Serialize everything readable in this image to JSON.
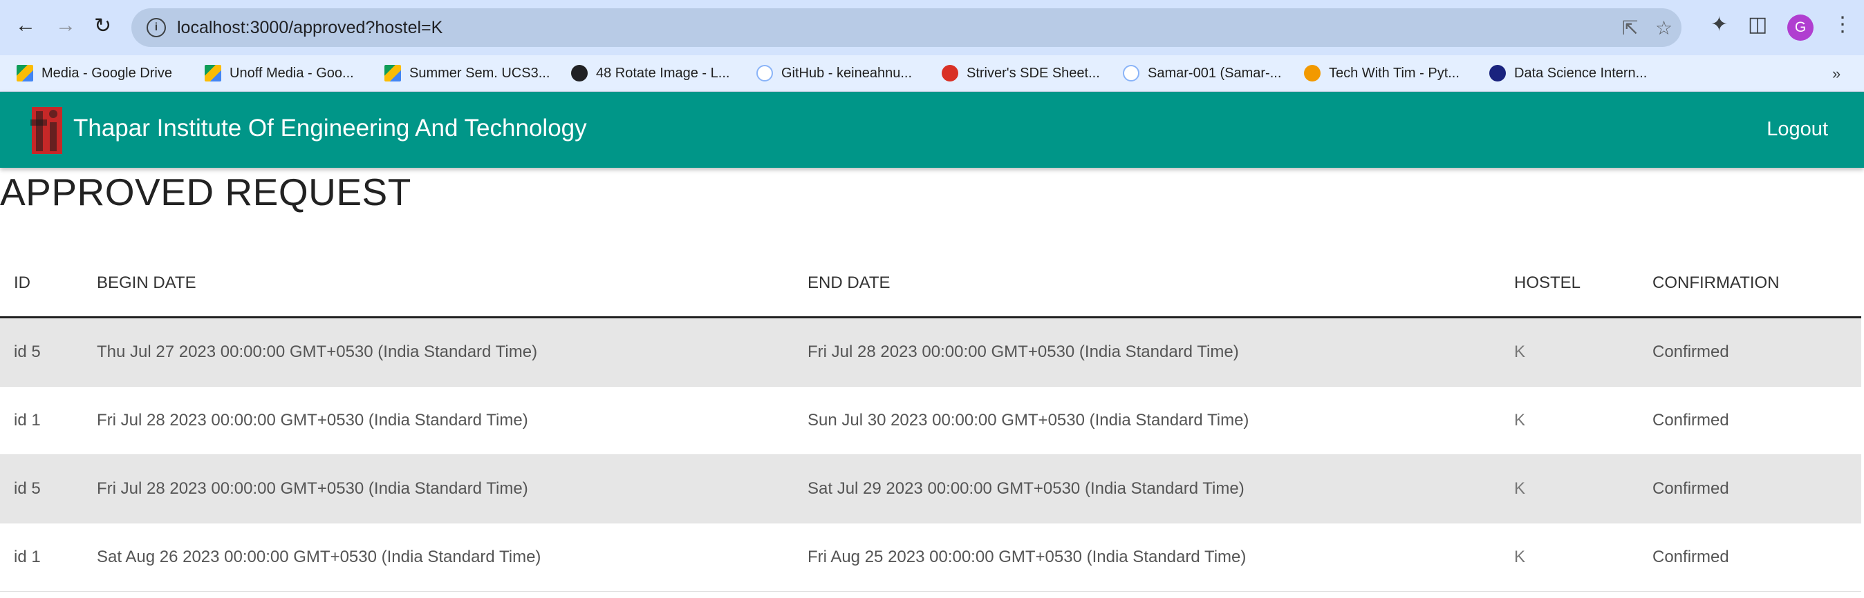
{
  "browser": {
    "url": "localhost:3000/approved?hostel=K",
    "avatar_letter": "G",
    "bookmarks": [
      {
        "label": "Media - Google Drive",
        "icon": "google-drive-icon"
      },
      {
        "label": "Unoff Media - Goo...",
        "icon": "google-drive-icon"
      },
      {
        "label": "Summer Sem. UCS3...",
        "icon": "google-drive-icon"
      },
      {
        "label": "48 Rotate Image - L...",
        "icon": "globe-icon"
      },
      {
        "label": "GitHub - keineahnu...",
        "icon": "github-icon"
      },
      {
        "label": "Striver's SDE Sheet...",
        "icon": "striver-icon"
      },
      {
        "label": "Samar-001 (Samar-...",
        "icon": "github-icon"
      },
      {
        "label": "Tech With Tim - Pyt...",
        "icon": "techwithtim-icon"
      },
      {
        "label": "Data Science Intern...",
        "icon": "unstop-icon"
      }
    ],
    "more": "»"
  },
  "header": {
    "title": "Thapar Institute Of Engineering And Technology",
    "logout_label": "Logout",
    "color": "#009688"
  },
  "page": {
    "title": "APPROVED REQUEST"
  },
  "table": {
    "columns": [
      "ID",
      "BEGIN DATE",
      "END DATE",
      "HOSTEL",
      "CONFIRMATION"
    ],
    "rows": [
      [
        "id 5",
        "Thu Jul 27 2023 00:00:00 GMT+0530 (India Standard Time)",
        "Fri Jul 28 2023 00:00:00 GMT+0530 (India Standard Time)",
        "K",
        "Confirmed"
      ],
      [
        "id 1",
        "Fri Jul 28 2023 00:00:00 GMT+0530 (India Standard Time)",
        "Sun Jul 30 2023 00:00:00 GMT+0530 (India Standard Time)",
        "K",
        "Confirmed"
      ],
      [
        "id 5",
        "Fri Jul 28 2023 00:00:00 GMT+0530 (India Standard Time)",
        "Sat Jul 29 2023 00:00:00 GMT+0530 (India Standard Time)",
        "K",
        "Confirmed"
      ],
      [
        "id 1",
        "Sat Aug 26 2023 00:00:00 GMT+0530 (India Standard Time)",
        "Fri Aug 25 2023 00:00:00 GMT+0530 (India Standard Time)",
        "K",
        "Confirmed"
      ]
    ]
  }
}
